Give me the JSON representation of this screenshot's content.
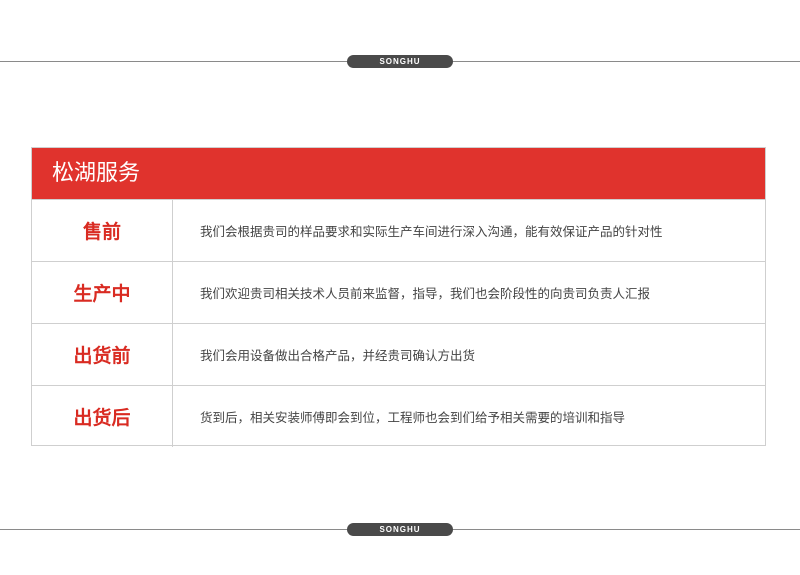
{
  "brand": {
    "top_label": "SONGHU",
    "bottom_label": "SONGHU"
  },
  "panel": {
    "title": "松湖服务",
    "rows": [
      {
        "label": "售前",
        "description": "我们会根据贵司的样品要求和实际生产车间进行深入沟通，能有效保证产品的针对性"
      },
      {
        "label": "生产中",
        "description": "我们欢迎贵司相关技术人员前来监督，指导，我们也会阶段性的向贵司负责人汇报"
      },
      {
        "label": "出货前",
        "description": "我们会用设备做出合格产品，并经贵司确认方出货"
      },
      {
        "label": "出货后",
        "description": "货到后，相关安装师傅即会到位，工程师也会到们给予相关需要的培训和指导"
      }
    ]
  },
  "colors": {
    "accent": "#e0332d",
    "label_text": "#d92b22",
    "pill": "#4a4a4a"
  }
}
